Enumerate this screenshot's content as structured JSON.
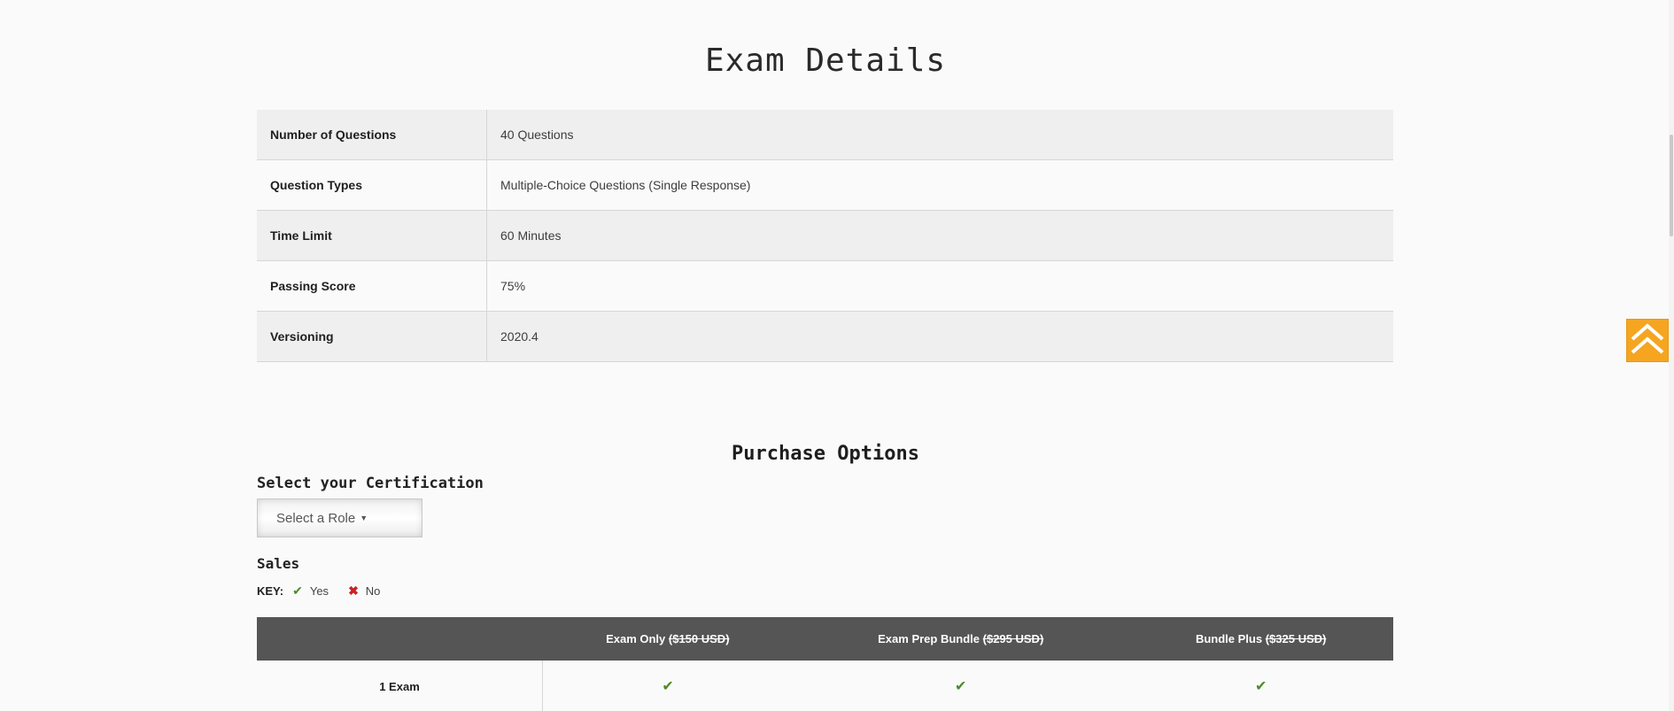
{
  "exam_details": {
    "title": "Exam Details",
    "rows": [
      {
        "label": "Number of Questions",
        "value": "40 Questions"
      },
      {
        "label": "Question Types",
        "value": "Multiple-Choice Questions (Single Response)"
      },
      {
        "label": "Time Limit",
        "value": "60 Minutes"
      },
      {
        "label": "Passing Score",
        "value": "75%"
      },
      {
        "label": "Versioning",
        "value": "2020.4"
      }
    ]
  },
  "purchase": {
    "title": "Purchase Options",
    "select_label": "Select your Certification",
    "select_value": "Select a Role",
    "category": "Sales",
    "key": {
      "label": "KEY:",
      "yes_glyph": "✔",
      "yes_label": "Yes",
      "no_glyph": "✖",
      "no_label": "No"
    },
    "columns": [
      {
        "name": "Exam Only",
        "price": "($150 USD)"
      },
      {
        "name": "Exam Prep Bundle",
        "price": "($295 USD)"
      },
      {
        "name": "Bundle Plus",
        "price": "($325 USD)"
      }
    ],
    "rows": [
      {
        "label": "1 Exam",
        "cells": [
          "✔",
          "✔",
          "✔"
        ]
      }
    ]
  },
  "ui": {
    "back_to_top_icon": "double-chevron-up-icon",
    "accent_color": "#f5a51f",
    "check_color": "#4b8b2b",
    "cross_color": "#cc2222",
    "header_bg": "#555555"
  }
}
